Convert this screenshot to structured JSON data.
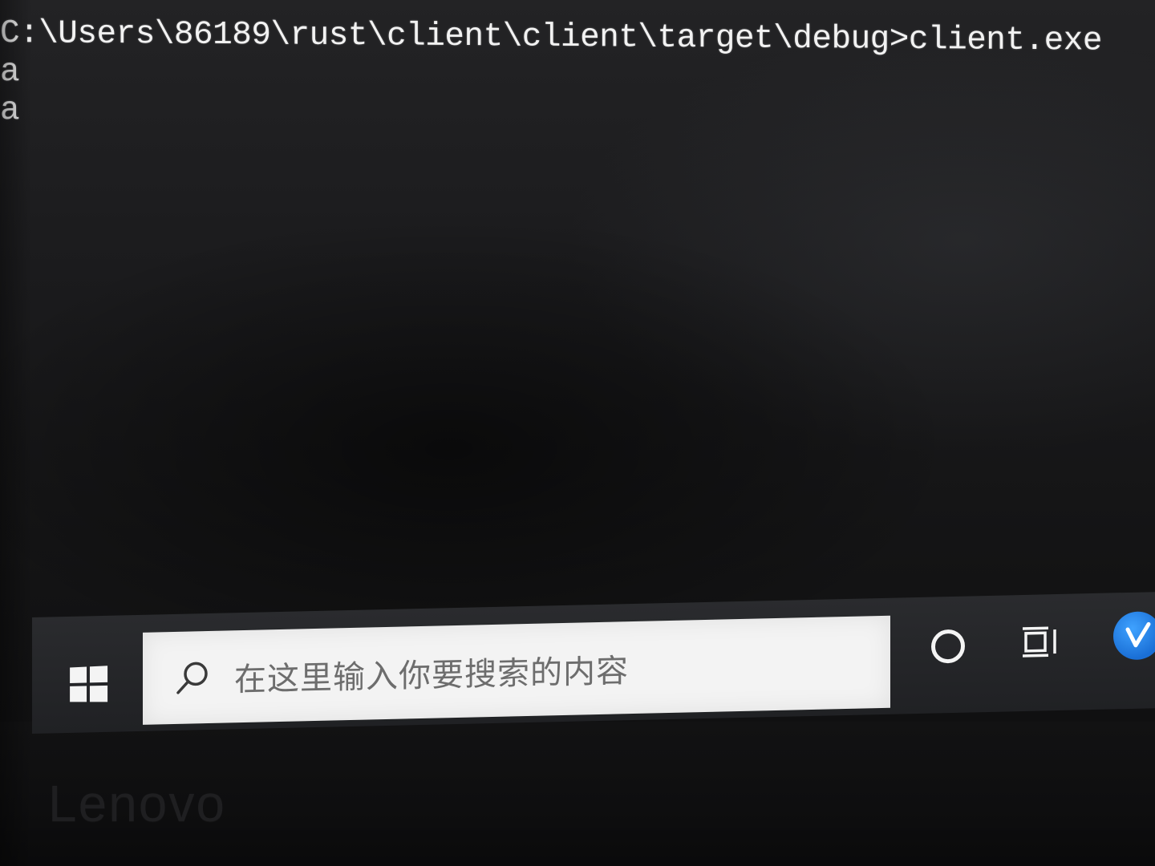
{
  "console": {
    "lines": [
      "C:\\Users\\86189\\rust\\client\\client\\target\\debug>client.exe",
      "a",
      "a"
    ]
  },
  "taskbar": {
    "search_placeholder": "在这里输入你要搜索的内容",
    "icons": [
      "windows-start-icon",
      "search-icon",
      "cortana-icon",
      "task-view-icon",
      "app-icon"
    ]
  },
  "bezel": {
    "brand": "Lenovo"
  },
  "colors": {
    "console_text": "#f2f2f2",
    "taskbar_bg": "#202124",
    "search_bg": "#f3f3f3",
    "app_icon_blue": "#1a6fd6"
  }
}
